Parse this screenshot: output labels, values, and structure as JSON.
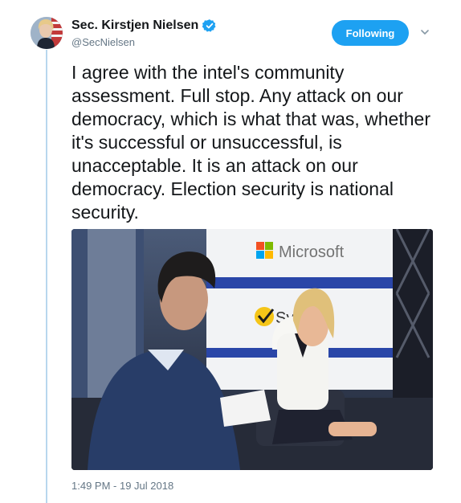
{
  "author": {
    "display_name": "Sec. Kirstjen Nielsen",
    "handle": "@SecNielsen",
    "verified_icon": "verified-badge-icon"
  },
  "follow": {
    "label": "Following",
    "color": "#1da1f2"
  },
  "menu": {
    "icon": "chevron-down-icon"
  },
  "tweet": {
    "text": "I agree with the intel's community assessment. Full stop. Any attack on our democracy, which is what that was, whether it's successful or unsuccessful, is unacceptable. It is an attack on our democracy. Election security is national security."
  },
  "photo": {
    "backdrop_logos": [
      "Microsoft",
      "Sy"
    ]
  },
  "timestamp": "1:49 PM - 19 Jul 2018",
  "colors": {
    "text": "#14171a",
    "secondary": "#657786",
    "thread_line": "#b8d7ee"
  }
}
